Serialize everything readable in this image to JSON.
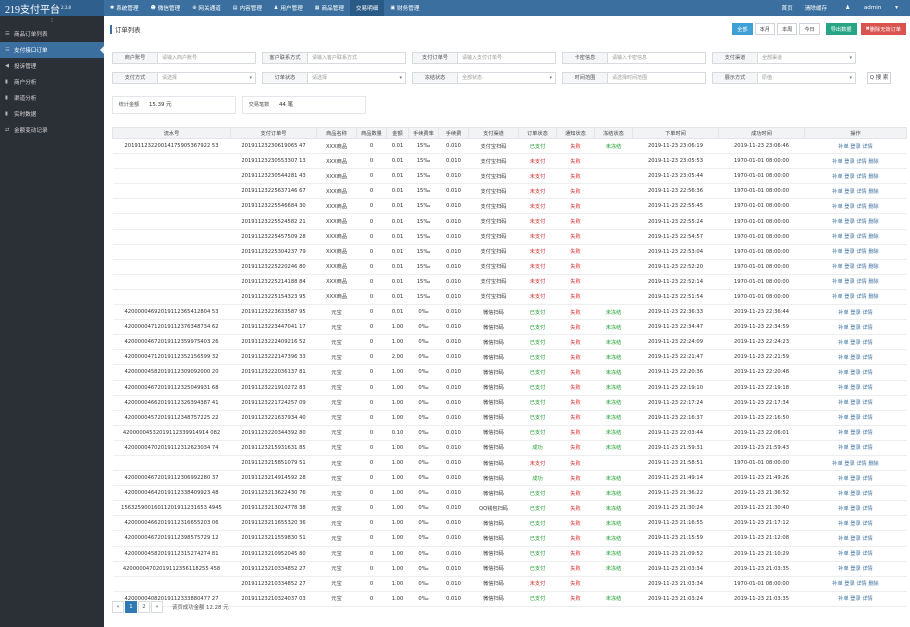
{
  "brand": {
    "name": "219支付平台",
    "version": "2.3.8"
  },
  "topnav": [
    {
      "icon": "✱",
      "icon_name": "gear-icon",
      "label": "系统管理"
    },
    {
      "icon": "☻",
      "icon_name": "chat-icon",
      "label": "微信管理"
    },
    {
      "icon": "⊕",
      "icon_name": "globe-icon",
      "label": "网关通道"
    },
    {
      "icon": "▤",
      "icon_name": "document-icon",
      "label": "内容管理"
    },
    {
      "icon": "♟",
      "icon_name": "user-icon",
      "label": "用户管理"
    },
    {
      "icon": "▦",
      "icon_name": "grid-icon",
      "label": "商品管理"
    },
    {
      "icon": "",
      "icon_name": "",
      "label": "交易明细"
    },
    {
      "icon": "▣",
      "icon_name": "finance-icon",
      "label": "财务管理"
    }
  ],
  "topright": {
    "home": "首页",
    "clear": "清除缓存",
    "user": "admin"
  },
  "sidebar": {
    "toggle": "⁝",
    "items": [
      {
        "icon": "☰",
        "icon_name": "list-icon",
        "label": "商品订单列表"
      },
      {
        "icon": "☰",
        "icon_name": "list-icon",
        "label": "支付接口订单"
      },
      {
        "icon": "◀",
        "icon_name": "bullhorn-icon",
        "label": "投诉管理"
      },
      {
        "icon": "▮",
        "icon_name": "bar-chart-icon",
        "label": "商户分析"
      },
      {
        "icon": "▮",
        "icon_name": "bar-chart-icon",
        "label": "渠道分析"
      },
      {
        "icon": "▮",
        "icon_name": "bar-chart-icon",
        "label": "实时数据"
      },
      {
        "icon": "⇄",
        "icon_name": "exchange-icon",
        "label": "金额变动记录"
      }
    ]
  },
  "page": {
    "title": "订单列表",
    "range_buttons": [
      "全部",
      "本月",
      "本周",
      "今日"
    ],
    "export_button": "导出数据",
    "delete_button": "删除无效订单"
  },
  "filters": {
    "row1": [
      {
        "label": "商户账号",
        "placeholder": "请输入商户账号",
        "select": false
      },
      {
        "label": "客户联系方式",
        "placeholder": "请输入客户联系方式",
        "select": false
      },
      {
        "label": "支付订单号",
        "placeholder": "请输入支付订单号",
        "select": false
      },
      {
        "label": "卡密信息",
        "placeholder": "请输入卡密信息",
        "select": false
      },
      {
        "label": "支付渠道",
        "placeholder": "全部渠道",
        "select": true
      }
    ],
    "row2": [
      {
        "label": "支付方式",
        "placeholder": "请选择",
        "select": true
      },
      {
        "label": "订单状态",
        "placeholder": "请选择",
        "select": true
      },
      {
        "label": "冻结状态",
        "placeholder": "全部状态",
        "select": true
      },
      {
        "label": "时间范围",
        "placeholder": "请选择时间范围",
        "select": false
      },
      {
        "label": "展示方式",
        "placeholder": "原值",
        "select": true
      }
    ],
    "search_button": "Q 搜 索"
  },
  "stats": [
    {
      "label": "统计金额",
      "value": "15.39 元"
    },
    {
      "label": "交易笔数",
      "value": "44 笔"
    }
  ],
  "table": {
    "columns": [
      "流水号",
      "支付订单号",
      "商品名称",
      "商品数量",
      "金额",
      "手续费率",
      "手续费",
      "支付渠道",
      "订单状态",
      "通知状态",
      "冻结状态",
      "下单时间",
      "成功时间",
      "操作"
    ],
    "rows": [
      [
        "20191123220014175905367922 53",
        "20191123230619065 47",
        "XXX商品",
        "0",
        "0.01",
        "15‰",
        "0.010",
        "支付宝扫码",
        "已支付",
        "失败",
        "未冻结",
        "2019-11-23 23:06:19",
        "2019-11-23 23:06:46",
        "补单 登录 详情"
      ],
      [
        "",
        "20191123230553307 13",
        "XXX商品",
        "0",
        "0.01",
        "15‰",
        "0.010",
        "支付宝扫码",
        "未支付",
        "失败",
        "",
        "2019-11-23 23:05:53",
        "1970-01-01 08:00:00",
        "补单 登录 详情 删除"
      ],
      [
        "",
        "20191123230544281 43",
        "XXX商品",
        "0",
        "0.01",
        "15‰",
        "0.010",
        "支付宝扫码",
        "未支付",
        "失败",
        "",
        "2019-11-23 23:05:44",
        "1970-01-01 08:00:00",
        "补单 登录 详情 删除"
      ],
      [
        "",
        "20191123225637146 67",
        "XXX商品",
        "0",
        "0.01",
        "15‰",
        "0.010",
        "支付宝扫码",
        "未支付",
        "失败",
        "",
        "2019-11-23 22:56:36",
        "1970-01-01 08:00:00",
        "补单 登录 详情 删除"
      ],
      [
        "",
        "20191123225546684 30",
        "XXX商品",
        "0",
        "0.01",
        "15‰",
        "0.010",
        "支付宝扫码",
        "未支付",
        "失败",
        "",
        "2019-11-23 22:55:45",
        "1970-01-01 08:00:00",
        "补单 登录 详情 删除"
      ],
      [
        "",
        "20191123225524582 21",
        "XXX商品",
        "0",
        "0.01",
        "15‰",
        "0.010",
        "支付宝扫码",
        "未支付",
        "失败",
        "",
        "2019-11-23 22:55:24",
        "1970-01-01 08:00:00",
        "补单 登录 详情 删除"
      ],
      [
        "",
        "20191123225457509 28",
        "XXX商品",
        "0",
        "0.01",
        "15‰",
        "0.010",
        "支付宝扫码",
        "未支付",
        "失败",
        "",
        "2019-11-23 22:54:57",
        "1970-01-01 08:00:00",
        "补单 登录 详情 删除"
      ],
      [
        "",
        "20191123225304237 79",
        "XXX商品",
        "0",
        "0.01",
        "15‰",
        "0.010",
        "支付宝扫码",
        "未支付",
        "失败",
        "",
        "2019-11-23 22:53:04",
        "1970-01-01 08:00:00",
        "补单 登录 详情 删除"
      ],
      [
        "",
        "20191123225220246 80",
        "XXX商品",
        "0",
        "0.01",
        "15‰",
        "0.010",
        "支付宝扫码",
        "未支付",
        "失败",
        "",
        "2019-11-23 22:52:20",
        "1970-01-01 08:00:00",
        "补单 登录 详情 删除"
      ],
      [
        "",
        "20191123225214188 84",
        "XXX商品",
        "0",
        "0.01",
        "15‰",
        "0.010",
        "支付宝扫码",
        "未支付",
        "失败",
        "",
        "2019-11-23 22:52:14",
        "1970-01-01 08:00:00",
        "补单 登录 详情 删除"
      ],
      [
        "",
        "20191123225154323 95",
        "XXX商品",
        "0",
        "0.01",
        "15‰",
        "0.010",
        "支付宝扫码",
        "未支付",
        "失败",
        "",
        "2019-11-23 22:51:54",
        "1970-01-01 08:00:00",
        "补单 登录 详情 删除"
      ],
      [
        "42000004692019112365412804 53",
        "20191123223633587 95",
        "元宝",
        "0",
        "0.01",
        "0‰",
        "0.010",
        "微信扫码",
        "已支付",
        "失败",
        "未冻结",
        "2019-11-23 22:36:33",
        "2019-11-23 22:36:44",
        "补单 登录 详情"
      ],
      [
        "42000004712019112376348734 62",
        "20191123223447041 17",
        "元宝",
        "0",
        "1.00",
        "0‰",
        "0.010",
        "微信扫码",
        "已支付",
        "失败",
        "未冻结",
        "2019-11-23 22:34:47",
        "2019-11-23 22:34:59",
        "补单 登录 详情"
      ],
      [
        "42000004672019112359975403 26",
        "20191123222409216 52",
        "元宝",
        "0",
        "1.00",
        "0‰",
        "0.010",
        "微信扫码",
        "已支付",
        "失败",
        "未冻结",
        "2019-11-23 22:24:09",
        "2019-11-23 22:24:23",
        "补单 登录 详情"
      ],
      [
        "42000004712019112352156599 32",
        "20191123222147396 33",
        "元宝",
        "0",
        "2.00",
        "0‰",
        "0.010",
        "微信扫码",
        "已支付",
        "失败",
        "未冻结",
        "2019-11-23 22:21:47",
        "2019-11-23 22:21:59",
        "补单 登录 详情"
      ],
      [
        "42000004582019112309092000 20",
        "20191123222036137 81",
        "元宝",
        "0",
        "1.00",
        "0‰",
        "0.010",
        "微信扫码",
        "已支付",
        "失败",
        "未冻结",
        "2019-11-23 22:20:36",
        "2019-11-23 22:20:48",
        "补单 登录 详情"
      ],
      [
        "42000004672019112325049931 68",
        "20191123221910272 83",
        "元宝",
        "0",
        "1.00",
        "0‰",
        "0.010",
        "微信扫码",
        "已支付",
        "失败",
        "未冻结",
        "2019-11-23 22:19:10",
        "2019-11-23 22:19:18",
        "补单 登录 详情"
      ],
      [
        "42000004662019112326394387 41",
        "20191123221724257 09",
        "元宝",
        "0",
        "1.00",
        "0‰",
        "0.010",
        "微信扫码",
        "已支付",
        "失败",
        "未冻结",
        "2019-11-23 22:17:24",
        "2019-11-23 22:17:34",
        "补单 登录 详情"
      ],
      [
        "42000004572019112348757225 22",
        "20191123221637934 40",
        "元宝",
        "0",
        "1.00",
        "0‰",
        "0.010",
        "微信扫码",
        "已支付",
        "失败",
        "未冻结",
        "2019-11-23 22:16:37",
        "2019-11-23 22:16:50",
        "补单 登录 详情"
      ],
      [
        "42000004532019112339914914 082",
        "20191123220344392 80",
        "元宝",
        "0",
        "0.10",
        "0‰",
        "0.010",
        "微信扫码",
        "已支付",
        "失败",
        "未冻结",
        "2019-11-23 22:03:44",
        "2019-11-23 22:06:01",
        "补单 登录 详情"
      ],
      [
        "42000004702019112312623034 74",
        "20191123215931631 85",
        "元宝",
        "0",
        "1.00",
        "0‰",
        "0.010",
        "微信扫码",
        "成功",
        "失败",
        "未冻结",
        "2019-11-23 21:59:31",
        "2019-11-23 21:59:43",
        "补单 登录 详情"
      ],
      [
        "",
        "20191123215851079 51",
        "元宝",
        "0",
        "1.00",
        "0‰",
        "0.010",
        "微信扫码",
        "未支付",
        "失败",
        "",
        "2019-11-23 21:58:51",
        "1970-01-01 08:00:00",
        "补单 登录 详情 删除"
      ],
      [
        "42000004672019112306992280 37",
        "20191123214914592 28",
        "元宝",
        "0",
        "1.00",
        "0‰",
        "0.010",
        "微信扫码",
        "成功",
        "失败",
        "未冻结",
        "2019-11-23 21:49:14",
        "2019-11-23 21:49:26",
        "补单 登录 详情"
      ],
      [
        "42000004642019112338409923 48",
        "20191123213622430 76",
        "元宝",
        "0",
        "1.00",
        "0‰",
        "0.010",
        "微信扫码",
        "已支付",
        "失败",
        "未冻结",
        "2019-11-23 21:36:22",
        "2019-11-23 21:36:52",
        "补单 登录 详情"
      ],
      [
        "15632590016011201911231653 4945",
        "20191123213024778 38",
        "元宝",
        "0",
        "1.00",
        "0‰",
        "0.010",
        "QQ钱包扫码",
        "已支付",
        "失败",
        "未冻结",
        "2019-11-23 21:30:24",
        "2019-11-23 21:30:40",
        "补单 登录 详情"
      ],
      [
        "42000004662019112316655203 06",
        "20191123211655320 36",
        "元宝",
        "0",
        "1.00",
        "0‰",
        "0.010",
        "微信扫码",
        "已支付",
        "失败",
        "未冻结",
        "2019-11-23 21:16:55",
        "2019-11-23 21:17:12",
        "补单 登录 详情"
      ],
      [
        "42000004672019112398575729 12",
        "20191123211559830 51",
        "元宝",
        "0",
        "1.00",
        "0‰",
        "0.010",
        "微信扫码",
        "已支付",
        "失败",
        "未冻结",
        "2019-11-23 21:15:59",
        "2019-11-23 21:12:08",
        "补单 登录 详情"
      ],
      [
        "42000004582019112315274274 81",
        "20191123210952045 80",
        "元宝",
        "0",
        "1.00",
        "0‰",
        "0.010",
        "微信扫码",
        "已支付",
        "失败",
        "未冻结",
        "2019-11-23 21:09:52",
        "2019-11-23 21:10:29",
        "补单 登录 详情"
      ],
      [
        "42000004702019112356118255 458",
        "20191123210334852 27",
        "元宝",
        "0",
        "1.00",
        "0‰",
        "0.010",
        "微信扫码",
        "已支付",
        "失败",
        "未冻结",
        "2019-11-23 21:03:34",
        "2019-11-23 21:03:35",
        "补单 登录 详情"
      ],
      [
        "",
        "20191123210334852 27",
        "元宝",
        "0",
        "1.00",
        "0‰",
        "0.010",
        "微信扫码",
        "未支付",
        "失败",
        "",
        "2019-11-23 21:03:34",
        "1970-01-01 08:00:00",
        "补单 登录 详情 删除"
      ],
      [
        "42000004082019112333880477 27",
        "20191123210324037 03",
        "元宝",
        "0",
        "1.00",
        "0‰",
        "0.010",
        "微信扫码",
        "已支付",
        "失败",
        "未冻结",
        "2019-11-23 21:03:24",
        "2019-11-23 21:03:35",
        "补单 登录 详情"
      ]
    ]
  },
  "pagination": {
    "prev": "«",
    "pages": [
      "1",
      "2"
    ],
    "current": "1",
    "next": "»",
    "info": "该页成功金额 12.28 元"
  }
}
